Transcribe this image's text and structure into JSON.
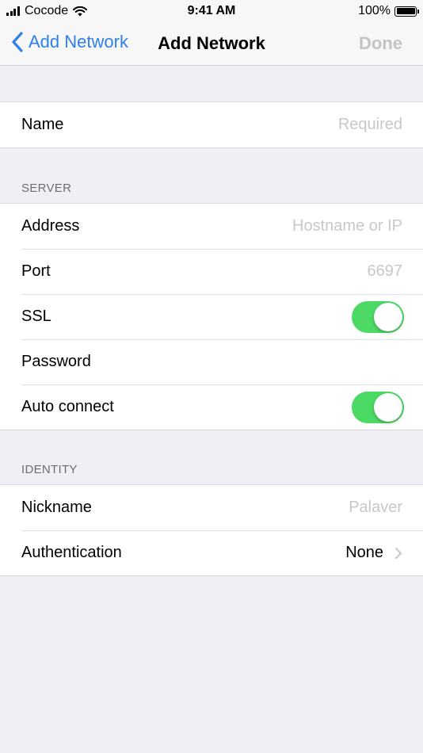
{
  "status_bar": {
    "carrier": "Cocode",
    "time": "9:41 AM",
    "battery": "100%"
  },
  "nav": {
    "back_label": "Add Network",
    "title": "Add Network",
    "done_label": "Done"
  },
  "name_section": {
    "label": "Name",
    "placeholder": "Required",
    "value": ""
  },
  "server": {
    "header": "SERVER",
    "address": {
      "label": "Address",
      "placeholder": "Hostname or IP",
      "value": ""
    },
    "port": {
      "label": "Port",
      "placeholder": "6697",
      "value": ""
    },
    "ssl": {
      "label": "SSL",
      "enabled": true
    },
    "password": {
      "label": "Password",
      "placeholder": "",
      "value": ""
    },
    "auto_connect": {
      "label": "Auto connect",
      "enabled": true
    }
  },
  "identity": {
    "header": "IDENTITY",
    "nickname": {
      "label": "Nickname",
      "placeholder": "Palaver",
      "value": ""
    },
    "authentication": {
      "label": "Authentication",
      "value": "None"
    }
  },
  "colors": {
    "accent": "#2f80ed",
    "toggle_on": "#4cd964",
    "background": "#efeff4",
    "placeholder": "#c7c7cd",
    "disabled": "#c4c4c8"
  },
  "icons": {
    "back": "chevron-left-icon",
    "disclosure": "chevron-right-icon",
    "wifi": "wifi-icon",
    "signal": "signal-bars-icon",
    "battery": "battery-icon"
  }
}
